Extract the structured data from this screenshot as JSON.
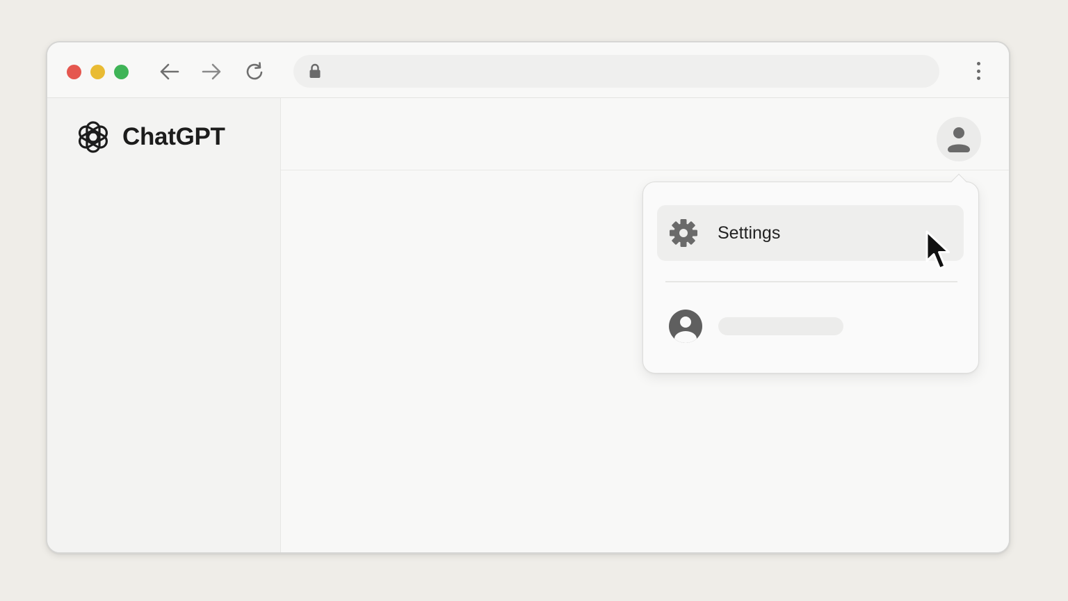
{
  "app": {
    "brand_name": "ChatGPT"
  },
  "browser": {
    "address_bar": {
      "url": ""
    },
    "icons": {
      "back": "arrow-left-icon",
      "forward": "arrow-right-icon",
      "reload": "reload-icon",
      "lock": "lock-icon",
      "menu": "more-vertical-icon"
    },
    "traffic_light_colors": [
      "#e5574f",
      "#e9bb33",
      "#3fb457"
    ]
  },
  "account_menu": {
    "items": [
      {
        "label": "Settings",
        "icon": "gear-icon",
        "state": "hovered"
      }
    ],
    "account_row": {
      "icon": "user-circle-icon"
    }
  },
  "colors": {
    "page_background": "#efede8",
    "window_background": "#f8f8f7",
    "hover_background": "#eeeeed",
    "icon_gray": "#6a6a6a"
  }
}
